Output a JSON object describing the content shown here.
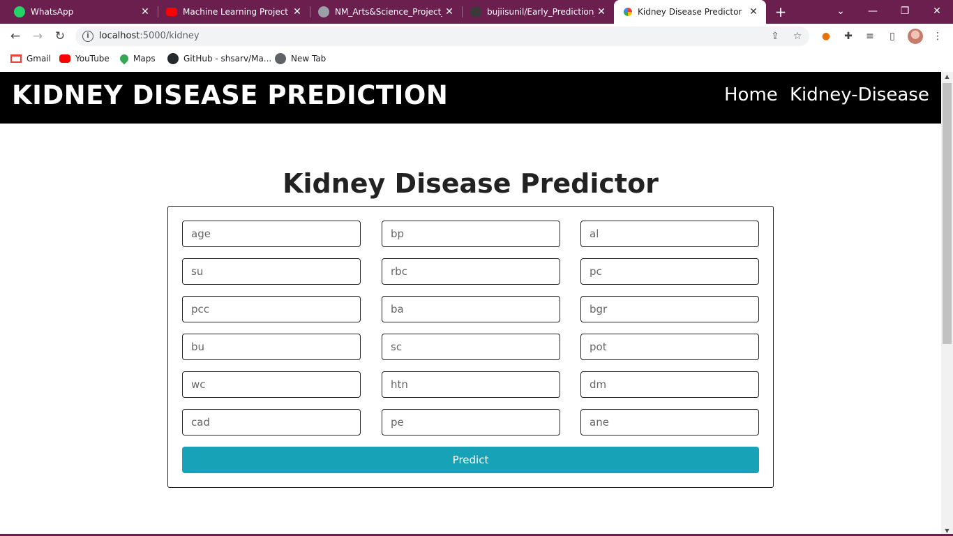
{
  "browser": {
    "tabs": [
      {
        "title": "WhatsApp",
        "icon": "whatsapp-icon",
        "color": "#25d366"
      },
      {
        "title": "Machine Learning Project File",
        "icon": "youtube-icon",
        "color": "#ff0000"
      },
      {
        "title": "NM_Arts&Science_Project_Details",
        "icon": "globe-icon",
        "color": "#9aa0a6"
      },
      {
        "title": "bujiisunil/Early_Prediction_for",
        "icon": "github-icon",
        "color": "#333333"
      },
      {
        "title": "Kidney Disease Predictor",
        "icon": "site-icon",
        "color": "#f4b400",
        "active": true
      }
    ],
    "new_tab": "+",
    "url_host": "localhost",
    "url_path": ":5000/kidney",
    "bookmarks": [
      {
        "label": "Gmail",
        "icon": "gmail-icon"
      },
      {
        "label": "YouTube",
        "icon": "youtube-icon"
      },
      {
        "label": "Maps",
        "icon": "maps-icon"
      },
      {
        "label": "GitHub - shsarv/Ma...",
        "icon": "github-icon"
      },
      {
        "label": "New Tab",
        "icon": "globe-icon"
      }
    ]
  },
  "site": {
    "brand": "KIDNEY DISEASE PREDICTION",
    "nav": [
      "Home",
      "Kidney-Disease"
    ],
    "title": "Kidney Disease Predictor",
    "fields": [
      "age",
      "bp",
      "al",
      "su",
      "rbc",
      "pc",
      "pcc",
      "ba",
      "bgr",
      "bu",
      "sc",
      "pot",
      "wc",
      "htn",
      "dm",
      "cad",
      "pe",
      "ane"
    ],
    "submit": "Predict",
    "accent": "#17a2b8"
  },
  "colors": {
    "tabstrip": "#6b1f4f",
    "header": "#000000"
  }
}
